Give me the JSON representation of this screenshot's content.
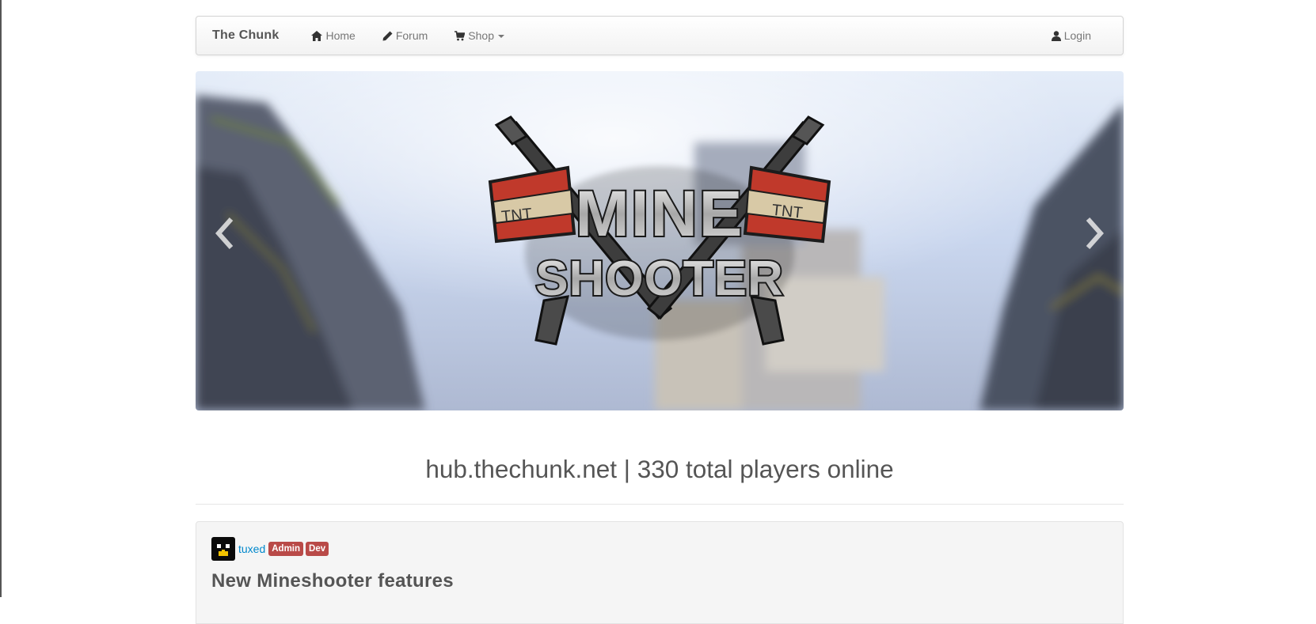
{
  "navbar": {
    "brand": "The Chunk",
    "items": [
      {
        "label": "Home",
        "icon": "home-icon"
      },
      {
        "label": "Forum",
        "icon": "pencil-icon"
      },
      {
        "label": "Shop",
        "icon": "cart-icon"
      }
    ],
    "login_label": "Login"
  },
  "carousel": {
    "logo_line1": "MINE",
    "logo_line2": "SHOOTER",
    "tnt_label": "TNT"
  },
  "status": {
    "text": "hub.thechunk.net | 330 total players online"
  },
  "post": {
    "author": "tuxed",
    "badges": [
      "Admin",
      "Dev"
    ],
    "title": "New Mineshooter features"
  },
  "colors": {
    "link": "#0088cc",
    "badge": "#b94a48",
    "text": "#555555"
  }
}
